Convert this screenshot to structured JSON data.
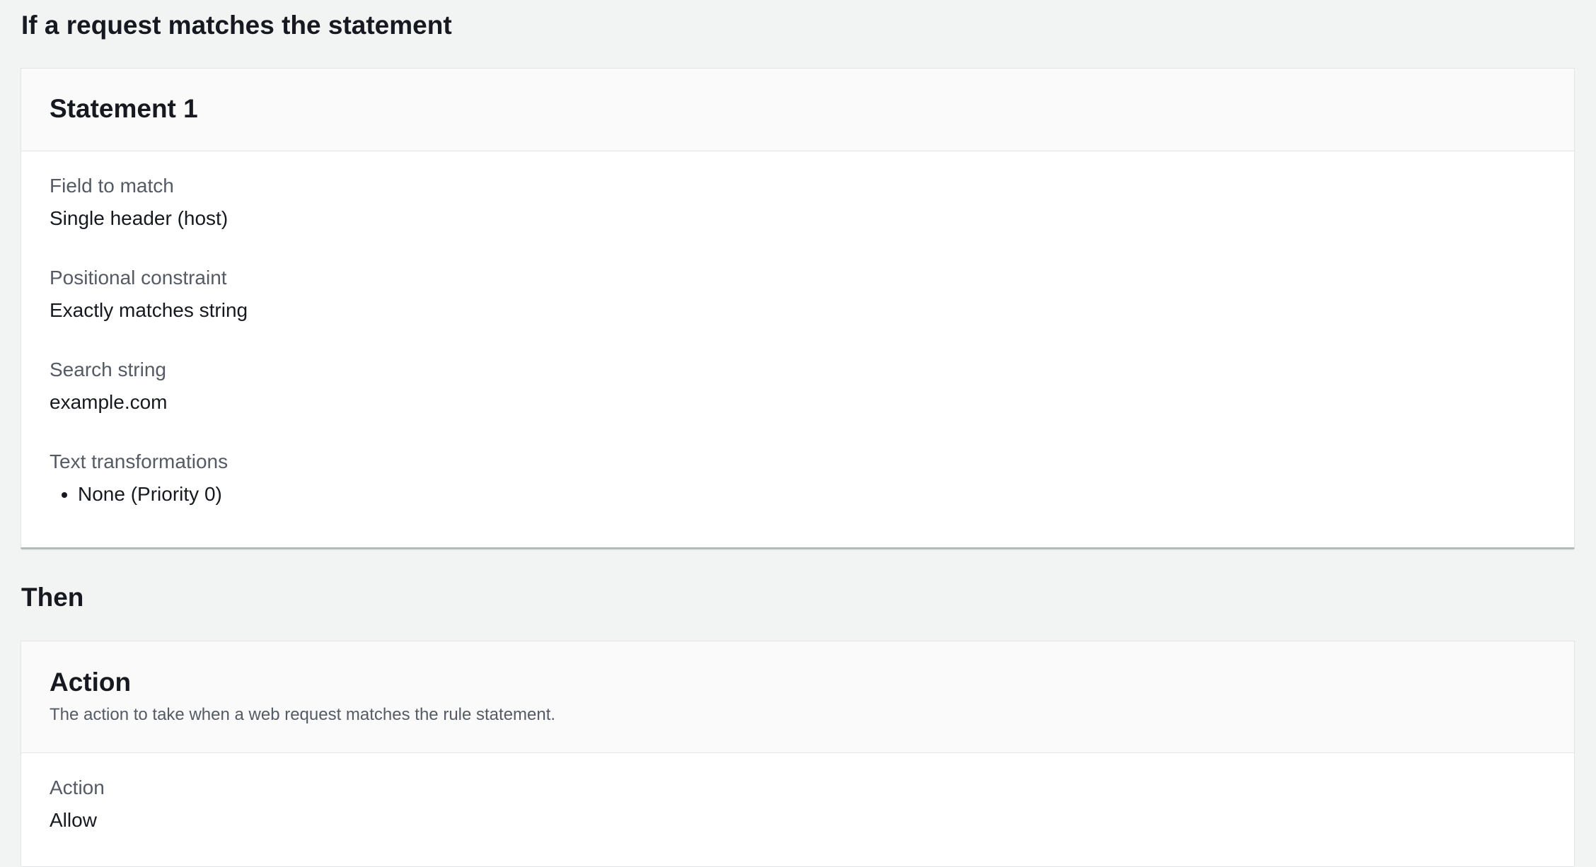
{
  "sections": {
    "if_heading": "If a request matches the statement",
    "then_heading": "Then"
  },
  "statement": {
    "title": "Statement 1",
    "fields": [
      {
        "label": "Field to match",
        "value": "Single header (host)"
      },
      {
        "label": "Positional constraint",
        "value": "Exactly matches string"
      },
      {
        "label": "Search string",
        "value": "example.com"
      }
    ],
    "text_transformations": {
      "label": "Text transformations",
      "items": [
        "None (Priority 0)"
      ]
    }
  },
  "action": {
    "title": "Action",
    "description": "The action to take when a web request matches the rule statement.",
    "field": {
      "label": "Action",
      "value": "Allow"
    }
  }
}
